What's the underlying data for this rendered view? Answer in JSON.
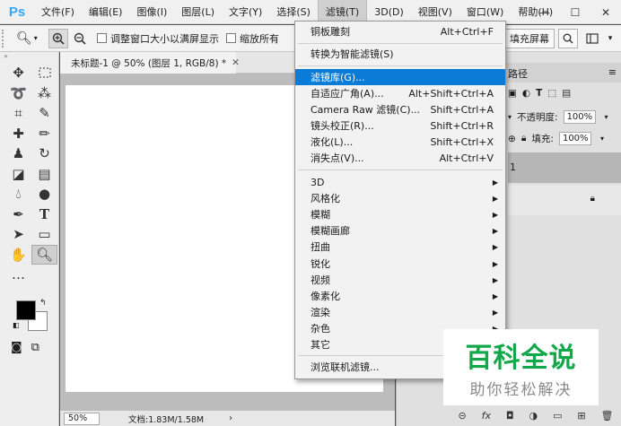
{
  "app": {
    "logo": "Ps"
  },
  "menubar": {
    "items": [
      "文件(F)",
      "编辑(E)",
      "图像(I)",
      "图层(L)",
      "文字(Y)",
      "选择(S)",
      "滤镜(T)",
      "3D(D)",
      "视图(V)",
      "窗口(W)",
      "帮助(H)"
    ],
    "active_index": 6
  },
  "options_bar": {
    "checkbox_resize": "调整窗口大小以满屏显示",
    "checkbox_zoom_all": "缩放所有",
    "fill_screen": "填充屏幕"
  },
  "document": {
    "tab_title": "未标题-1 @ 50% (图层 1, RGB/8) *",
    "zoom": "50%",
    "doc_info": "文档:1.83M/1.58M"
  },
  "filter_menu": {
    "items": [
      {
        "label": "铜板雕刻",
        "shortcut": "Alt+Ctrl+F"
      },
      {
        "label": "转换为智能滤镜(S)"
      },
      {
        "label": "滤镜库(G)...",
        "highlighted": true
      },
      {
        "label": "自适应广角(A)...",
        "shortcut": "Alt+Shift+Ctrl+A"
      },
      {
        "label": "Camera Raw 滤镜(C)...",
        "shortcut": "Shift+Ctrl+A"
      },
      {
        "label": "镜头校正(R)...",
        "shortcut": "Shift+Ctrl+R"
      },
      {
        "label": "液化(L)...",
        "shortcut": "Shift+Ctrl+X"
      },
      {
        "label": "消失点(V)...",
        "shortcut": "Alt+Ctrl+V"
      },
      {
        "label": "3D",
        "submenu": true
      },
      {
        "label": "风格化",
        "submenu": true
      },
      {
        "label": "模糊",
        "submenu": true
      },
      {
        "label": "模糊画廊",
        "submenu": true
      },
      {
        "label": "扭曲",
        "submenu": true
      },
      {
        "label": "锐化",
        "submenu": true
      },
      {
        "label": "视频",
        "submenu": true
      },
      {
        "label": "像素化",
        "submenu": true
      },
      {
        "label": "渲染",
        "submenu": true
      },
      {
        "label": "杂色",
        "submenu": true
      },
      {
        "label": "其它",
        "submenu": true
      },
      {
        "label": "浏览联机滤镜..."
      }
    ]
  },
  "layers_panel": {
    "tab_label": "路径",
    "opacity_label": "不透明度:",
    "opacity_value": "100%",
    "fill_label": "填充:",
    "fill_value": "100%",
    "layer_name": "1"
  },
  "watermark": {
    "title": "百科全说",
    "subtitle": "助你轻松解决"
  }
}
